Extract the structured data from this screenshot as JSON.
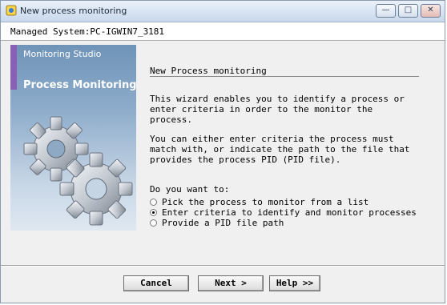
{
  "window": {
    "title": "New process monitoring",
    "controls": {
      "minimize": "—",
      "maximize": "□",
      "close": "✕"
    }
  },
  "header": {
    "managed_system": "Managed System:PC-IGWIN7_3181"
  },
  "banner": {
    "subtitle": "Monitoring Studio",
    "title": "Process Monitoring",
    "icon": "gears-icon"
  },
  "content": {
    "title": "New Process monitoring",
    "paragraph1": "This wizard enables you to identify a process or\nenter criteria in order to the monitor the\nprocess.",
    "paragraph2": "You can either enter criteria the process must\nmatch with, or indicate the path to the file that\nprovides the process PID (PID file).",
    "question": "Do you want to:",
    "options": [
      {
        "label": "Pick the process to monitor from a list",
        "selected": false
      },
      {
        "label": "Enter criteria to identify and monitor processes",
        "selected": true
      },
      {
        "label": "Provide a PID file path",
        "selected": false
      }
    ]
  },
  "buttons": {
    "cancel": "Cancel",
    "next": "Next >",
    "help": "Help >>"
  }
}
